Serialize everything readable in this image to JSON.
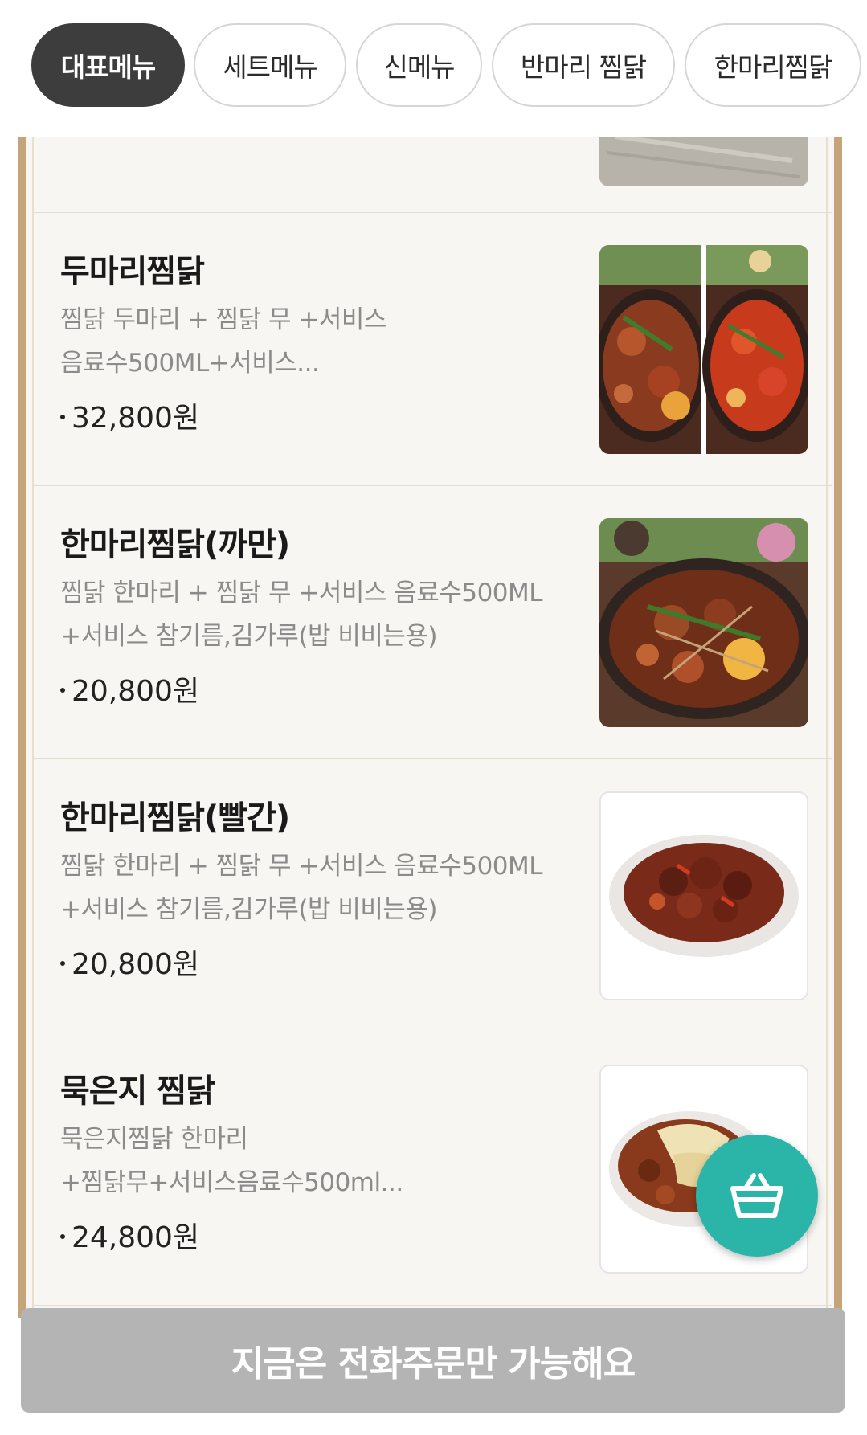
{
  "tabs": [
    {
      "label": "대표메뉴",
      "active": true
    },
    {
      "label": "세트메뉴",
      "active": false
    },
    {
      "label": "신메뉴",
      "active": false
    },
    {
      "label": "반마리 찜닭",
      "active": false
    },
    {
      "label": "한마리찜닭",
      "active": false
    }
  ],
  "menu_items": [
    {
      "name": "두마리찜닭",
      "description": "찜닭 두마리 + 찜닭 무 +서비스\n음료수500ML+서비스...",
      "price": "32,800원"
    },
    {
      "name": "한마리찜닭(까만)",
      "description": "찜닭 한마리 + 찜닭 무 +서비스 음료수500ML\n+서비스 참기름,김가루(밥 비비는용)",
      "price": "20,800원"
    },
    {
      "name": "한마리찜닭(빨간)",
      "description": "찜닭 한마리 + 찜닭 무 +서비스 음료수500ML\n+서비스 참기름,김가루(밥 비비는용)",
      "price": "20,800원"
    },
    {
      "name": "묵은지 찜닭",
      "description": "묵은지찜닭 한마리\n+찜닭무+서비스음료수500ml...",
      "price": "24,800원"
    }
  ],
  "icons": {
    "cart": "shopping-basket-icon"
  },
  "colors": {
    "active_tab": "#3d3d3d",
    "fab": "#2bb4a8",
    "order_bar": "#b4b4b4",
    "board_frame": "#c6a47a"
  },
  "order_bar": {
    "label": "지금은 전화주문만 가능해요"
  }
}
